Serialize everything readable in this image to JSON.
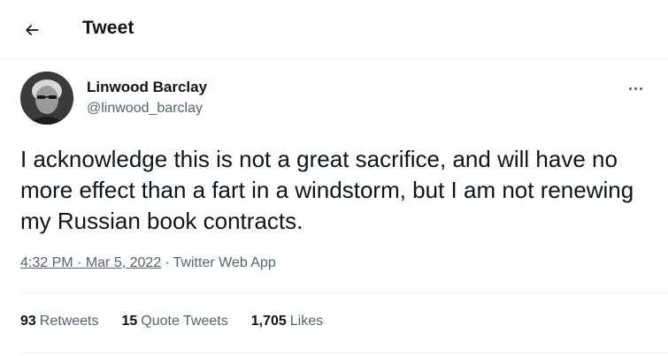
{
  "header": {
    "title": "Tweet",
    "back_icon": "arrow-left-icon"
  },
  "tweet": {
    "author": {
      "name": "Linwood Barclay",
      "handle": "@linwood_barclay"
    },
    "more_icon": "more-horizontal-icon",
    "text": "I acknowledge this is not a great sacrifice, and will have no more effect than a fart in a windstorm, but I am not renewing my Russian book contracts.",
    "time": "4:32 PM",
    "date": "Mar 5, 2022",
    "source": "Twitter Web App",
    "separator": "·"
  },
  "stats": {
    "retweets": {
      "count": "93",
      "label": "Retweets"
    },
    "quote_tweets": {
      "count": "15",
      "label": "Quote Tweets"
    },
    "likes": {
      "count": "1,705",
      "label": "Likes"
    }
  },
  "colors": {
    "text_primary": "#0f1419",
    "text_secondary": "#536471",
    "divider": "#eff3f4"
  }
}
